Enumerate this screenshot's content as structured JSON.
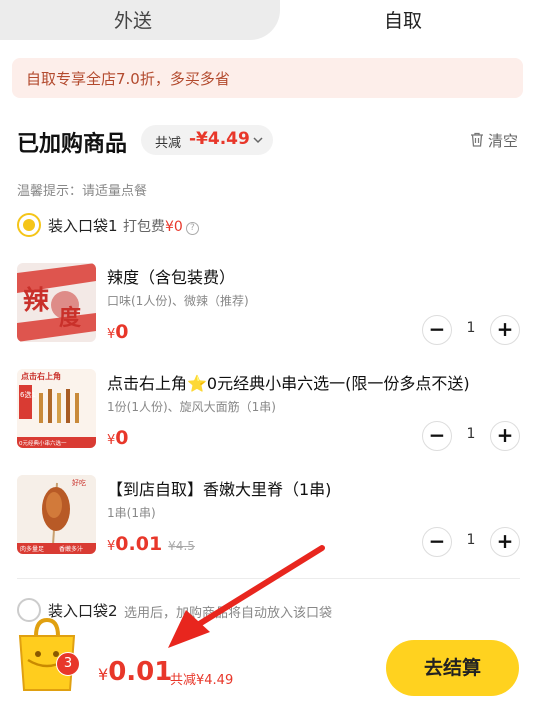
{
  "tabs": {
    "delivery": "外送",
    "pickup": "自取"
  },
  "promo": {
    "text": "自取专享全店7.0折，多买多省"
  },
  "header": {
    "title": "已加购商品",
    "discount_label": "共减",
    "discount_amount": "-¥4.49",
    "clear": "清空"
  },
  "tip": "温馨提示：请适量点餐",
  "bag1": {
    "name": "装入口袋1",
    "fee_label": "打包费",
    "fee_value": "¥0"
  },
  "items": [
    {
      "name": "辣度（含包装费）",
      "desc": "口味(1人份)、微辣（推荐)",
      "currency": "¥",
      "price": "0",
      "old_price": "",
      "qty": "1",
      "thumb_text": [
        "辣",
        "度"
      ]
    },
    {
      "name": "点击右上角⭐0元经典小串六选一(限一份多点不送)",
      "desc": "1份(1人份)、旋风大面筋（1串)",
      "currency": "¥",
      "price": "0",
      "old_price": "",
      "qty": "1",
      "thumb_text": [
        "点击右上角",
        "6选1",
        "0元经典小串六选一"
      ]
    },
    {
      "name": "【到店自取】香嫩大里脊（1串)",
      "desc": "1串(1串)",
      "currency": "¥",
      "price": "0.01",
      "old_price": "¥4.5",
      "qty": "1",
      "thumb_text": [
        "好吃",
        "肉多量足",
        "香嫩多汁"
      ]
    }
  ],
  "bag2": {
    "name": "装入口袋2",
    "desc": "选用后，加购商品将自动放入该口袋"
  },
  "bottom": {
    "badge": "3",
    "currency": "¥",
    "total": "0.01",
    "discount": "共减¥4.49",
    "checkout": "去结算"
  },
  "colors": {
    "accent": "#ffd21f",
    "price": "#e8372a",
    "promo_bg": "#fdeeea",
    "arrow": "#e8261e"
  }
}
